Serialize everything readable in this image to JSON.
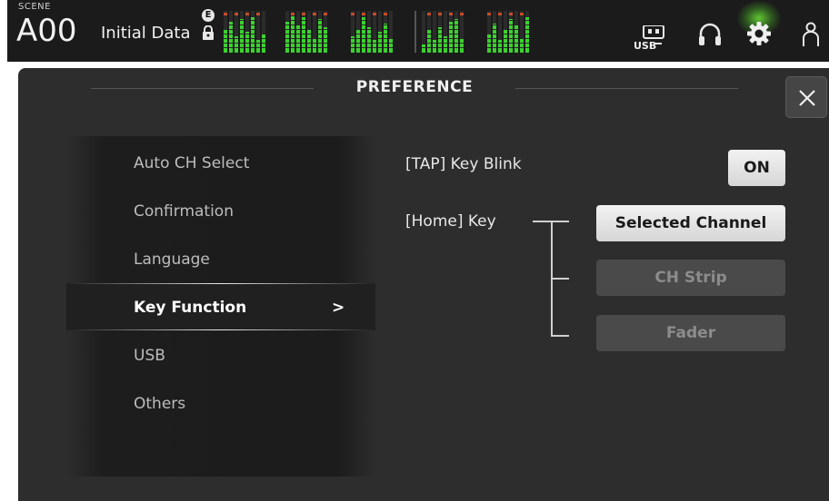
{
  "header": {
    "scene_label": "SCENE",
    "scene_number": "A00",
    "scene_name": "Initial Data",
    "edit_flag": "E",
    "icons": [
      "lock-icon",
      "usb-icon",
      "headphones-icon",
      "gear-icon",
      "user-icon"
    ]
  },
  "meters": {
    "groups": [
      [
        0.55,
        0.75,
        0.4,
        0.8,
        0.5,
        0.85,
        0.3,
        0.45
      ],
      [
        0.75,
        0.9,
        0.65,
        0.85,
        0.55,
        0.35,
        0.8,
        0.6
      ],
      [
        0.4,
        0.55,
        0.85,
        0.6,
        0.3,
        0.5,
        0.7,
        0.35
      ],
      [
        0.2,
        0.55,
        0.3,
        0.6,
        0.4,
        0.75,
        0.8,
        0.35
      ],
      [
        0.45,
        0.7,
        0.3,
        0.55,
        0.8,
        0.65,
        0.35,
        0.85
      ]
    ],
    "colors": {
      "level": "#3bd12e",
      "peak": "#c74b2a"
    }
  },
  "dialog": {
    "title": "PREFERENCE",
    "close_label": "×"
  },
  "menu": {
    "items": [
      {
        "label": "Auto CH Select"
      },
      {
        "label": "Confirmation"
      },
      {
        "label": "Language"
      },
      {
        "label": "Key Function",
        "selected": true,
        "arrow": ">"
      },
      {
        "label": "USB"
      },
      {
        "label": "Others"
      }
    ]
  },
  "settings": {
    "tap_key_blink": {
      "label": "[TAP] Key Blink",
      "value": "ON"
    },
    "home_key": {
      "label": "[Home] Key",
      "options": [
        "Selected Channel",
        "CH Strip",
        "Fader"
      ],
      "selected": "Selected Channel"
    }
  },
  "colors": {
    "accent_glow": "#78ff3c",
    "panel_bg": "#2d2d2d",
    "topbar_bg": "#1b1b1b"
  }
}
